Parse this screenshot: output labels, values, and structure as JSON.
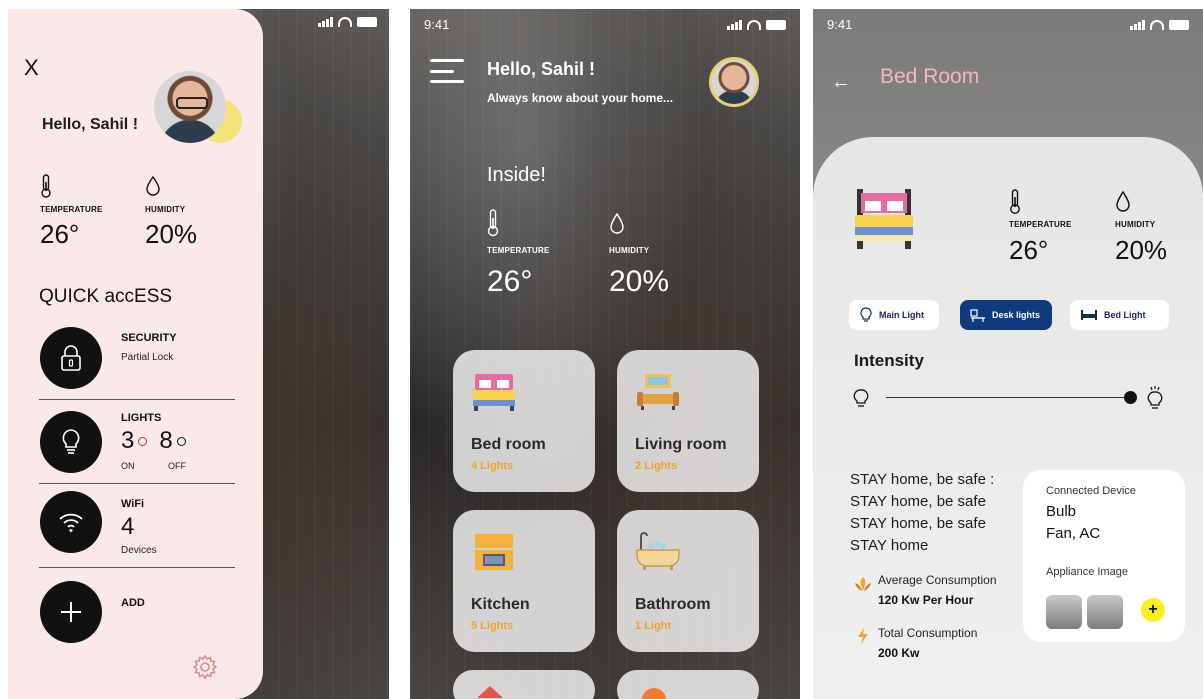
{
  "status": {
    "time": "9:41"
  },
  "drawer": {
    "close": "X",
    "greeting": "Hello, Sahil !",
    "temperature": {
      "label": "TEMPERATURE",
      "value": "26°"
    },
    "humidity": {
      "label": "HUMIDITY",
      "value": "20%"
    },
    "quick_access_title": "QUICK accESS",
    "items": [
      {
        "title": "SECURITY",
        "subtitle": "Partial Lock"
      },
      {
        "title": "LIGHTS",
        "on_count": "3",
        "off_count": "8",
        "on_label": "ON",
        "off_label": "OFF"
      },
      {
        "title": "WiFi",
        "count": "4",
        "subtitle": "Devices"
      },
      {
        "title": "ADD"
      }
    ]
  },
  "home": {
    "greeting": "Hello, Sahil !",
    "subtitle": "Always know about your home...",
    "inside": "Inside!",
    "temperature": {
      "label": "TEMPERATURE",
      "value": "26°"
    },
    "humidity": {
      "label": "HUMIDITY",
      "value": "20%"
    },
    "rooms": [
      {
        "name": "Bed room",
        "count": "4 Lights"
      },
      {
        "name": "Living room",
        "count": "2 Lights"
      },
      {
        "name": "Kitchen",
        "count": "5 Lights"
      },
      {
        "name": "Bathroom",
        "count": "1 Light"
      }
    ]
  },
  "room": {
    "back": "←",
    "title": "Bed Room",
    "temperature": {
      "label": "TEMPERATURE",
      "value": "26°"
    },
    "humidity": {
      "label": "HUMIDITY",
      "value": "20%"
    },
    "lights": [
      {
        "label": "Main Light",
        "active": false
      },
      {
        "label": "Desk lights",
        "active": true
      },
      {
        "label": "Bed Light",
        "active": false
      }
    ],
    "intensity_label": "Intensity",
    "intensity_level": 1.0,
    "stay_lines": [
      "STAY home, be safe :",
      "STAY home, be safe",
      "STAY home, be safe",
      "STAY home"
    ],
    "avg_consumption": {
      "label": "Average Consumption",
      "value": "120 Kw Per Hour"
    },
    "total_consumption": {
      "label": "Total Consumption",
      "value": "200 Kw"
    },
    "connected": {
      "label": "Connected Device",
      "devices": [
        "Bulb",
        "Fan, AC"
      ]
    },
    "appliance_label": "Appliance Image",
    "add_symbol": "+"
  },
  "colors": {
    "drawer_bg": "#fbe9ea",
    "accent_orange": "#f0a32e",
    "room_title": "#f3b8bd",
    "active_pill": "#0f3a7e",
    "yellow": "#f8ef22"
  }
}
